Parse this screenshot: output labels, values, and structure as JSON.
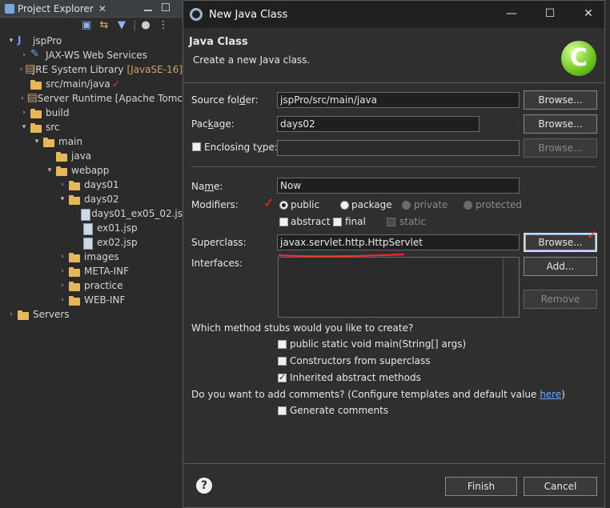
{
  "explorer": {
    "title": "Project Explorer",
    "tree": [
      {
        "label": "jspPro",
        "level": 0,
        "arrow": "▾",
        "icon": "project-icon"
      },
      {
        "label": "JAX-WS Web Services",
        "level": 1,
        "arrow": "›",
        "icon": "webservice-icon"
      },
      {
        "label": "JRE System Library",
        "decor": "[JavaSE-16]",
        "level": 1,
        "arrow": "›",
        "icon": "library-icon"
      },
      {
        "label": "src/main/java",
        "level": 1,
        "arrow": "",
        "icon": "folder-icon"
      },
      {
        "label": "Server Runtime [Apache Tomc",
        "level": 1,
        "arrow": "›",
        "icon": "library-icon"
      },
      {
        "label": "build",
        "level": 1,
        "arrow": "›",
        "icon": "folder-icon"
      },
      {
        "label": "src",
        "level": 1,
        "arrow": "▾",
        "icon": "folder-icon"
      },
      {
        "label": "main",
        "level": 2,
        "arrow": "▾",
        "icon": "folder-icon"
      },
      {
        "label": "java",
        "level": 3,
        "arrow": "",
        "icon": "folder-icon"
      },
      {
        "label": "webapp",
        "level": 3,
        "arrow": "▾",
        "icon": "folder-icon"
      },
      {
        "label": "days01",
        "level": 4,
        "arrow": "›",
        "icon": "folder-icon"
      },
      {
        "label": "days02",
        "level": 4,
        "arrow": "▾",
        "icon": "folder-icon"
      },
      {
        "label": "days01_ex05_02.js",
        "level": 5,
        "arrow": "",
        "icon": "file-icon"
      },
      {
        "label": "ex01.jsp",
        "level": 5,
        "arrow": "",
        "icon": "file-icon"
      },
      {
        "label": "ex02.jsp",
        "level": 5,
        "arrow": "",
        "icon": "file-icon"
      },
      {
        "label": "images",
        "level": 4,
        "arrow": "›",
        "icon": "folder-icon"
      },
      {
        "label": "META-INF",
        "level": 4,
        "arrow": "›",
        "icon": "folder-icon"
      },
      {
        "label": "practice",
        "level": 4,
        "arrow": "›",
        "icon": "folder-icon"
      },
      {
        "label": "WEB-INF",
        "level": 4,
        "arrow": "›",
        "icon": "folder-icon"
      },
      {
        "label": "Servers",
        "level": 0,
        "arrow": "›",
        "icon": "folder-icon"
      }
    ]
  },
  "dialog": {
    "window_title": "New Java Class",
    "header_title": "Java Class",
    "header_desc": "Create a new Java class.",
    "banner_letter": "C",
    "source_folder": {
      "label_pre": "Source fol",
      "label_mn": "d",
      "label_post": "er:",
      "value": "jspPro/src/main/java",
      "browse": "Browse..."
    },
    "package": {
      "label_pre": "Pac",
      "label_mn": "k",
      "label_post": "age:",
      "value": "days02",
      "browse": "Browse..."
    },
    "enclosing": {
      "label_pre": "Enclosing t",
      "label_mn": "y",
      "label_post": "pe:",
      "value": "",
      "browse": "Browse..."
    },
    "name": {
      "label_pre": "Na",
      "label_mn": "m",
      "label_post": "e:",
      "value": "Now"
    },
    "modifiers_label": "Modifiers:",
    "modifiers": {
      "public": "public",
      "package": "package",
      "private": "private",
      "protected": "protected",
      "abstract": "abstract",
      "final": "final",
      "static": "static"
    },
    "superclass": {
      "label": "Superclass:",
      "value": "javax.servlet.http.HttpServlet",
      "browse": "Browse..."
    },
    "interfaces": {
      "label": "Interfaces:",
      "add": "Add...",
      "remove": "Remove"
    },
    "stubs_question": "Which method stubs would you like to create?",
    "stubs": {
      "main": "public static void main(String[] args)",
      "constructors": "Constructors from superclass",
      "inherited": "Inherited abstract methods"
    },
    "comments_question": "Do you want to add comments? (Configure templates and default value ",
    "comments_link": "here",
    "comments_close": ")",
    "generate_comments": "Generate comments",
    "finish": "Finish",
    "cancel": "Cancel",
    "help": "?"
  },
  "colors": {
    "annotation_red": "#ff2a2a",
    "banner_green": "#6cc41f",
    "link_blue": "#6aa8ff"
  }
}
